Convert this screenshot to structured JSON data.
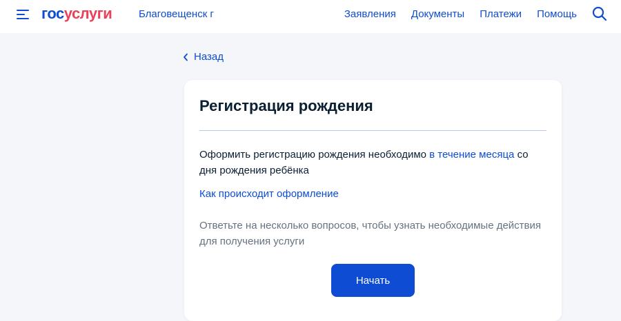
{
  "header": {
    "logo_part1": "гос",
    "logo_part2": "услуги",
    "city": "Благовещенск г",
    "nav": [
      "Заявления",
      "Документы",
      "Платежи",
      "Помощь"
    ],
    "menu_icon": "burger-menu-icon",
    "search_icon": "search-icon"
  },
  "back": {
    "label": "Назад",
    "icon": "chevron-left-icon"
  },
  "card": {
    "title": "Регистрация рождения",
    "intro_before": "Оформить регистрацию рождения необходимо ",
    "intro_link": "в течение месяца",
    "intro_after": " со дня рождения ребёнка",
    "how_link": "Как происходит оформление",
    "hint": "Ответьте на несколько вопросов, чтобы узнать необходимые действия для получения услуги",
    "start_label": "Начать"
  },
  "colors": {
    "brand_blue": "#0d4cd3",
    "brand_red": "#ee3f58",
    "text": "#0b1f33",
    "muted": "#66727f",
    "background": "#f4f6fa"
  }
}
